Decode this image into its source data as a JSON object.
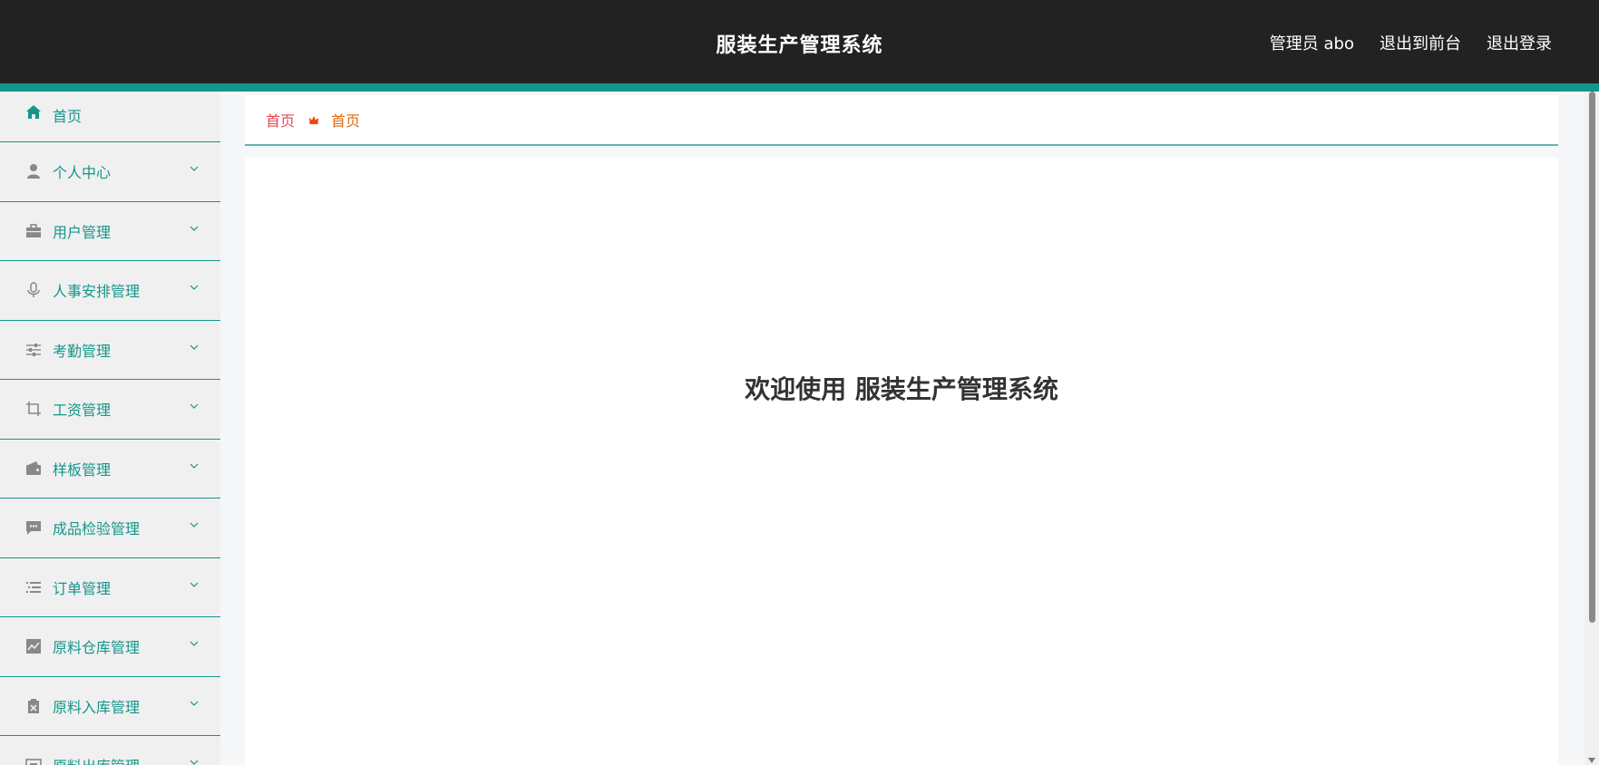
{
  "header": {
    "title": "服装生产管理系统",
    "user": "管理员 abo",
    "to_front": "退出到前台",
    "logout": "退出登录"
  },
  "sidebar": {
    "items": [
      {
        "label": "首页",
        "icon": "home-icon"
      },
      {
        "label": "个人中心",
        "icon": "person-icon"
      },
      {
        "label": "用户管理",
        "icon": "briefcase-icon"
      },
      {
        "label": "人事安排管理",
        "icon": "microphone-icon"
      },
      {
        "label": "考勤管理",
        "icon": "sliders-icon"
      },
      {
        "label": "工资管理",
        "icon": "crop-icon"
      },
      {
        "label": "样板管理",
        "icon": "wallet-icon"
      },
      {
        "label": "成品检验管理",
        "icon": "chat-icon"
      },
      {
        "label": "订单管理",
        "icon": "list-icon"
      },
      {
        "label": "原料仓库管理",
        "icon": "chart-icon"
      },
      {
        "label": "原料入库管理",
        "icon": "clipboard-x-icon"
      },
      {
        "label": "原料出库管理",
        "icon": "box-icon"
      }
    ]
  },
  "breadcrumb": {
    "home": "首页",
    "current": "首页"
  },
  "main": {
    "welcome": "欢迎使用 服装生产管理系统"
  },
  "colors": {
    "accent": "#14968b",
    "header_bg": "#222222",
    "crumb_home": "#e8474e",
    "crumb_current": "#e06a12"
  }
}
